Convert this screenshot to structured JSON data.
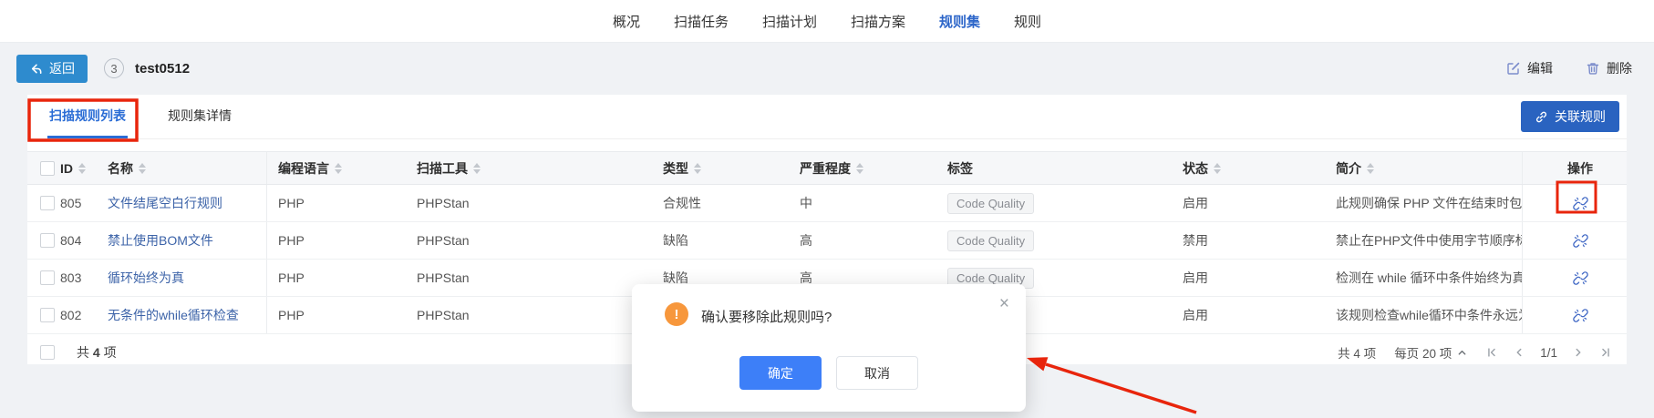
{
  "nav": {
    "items": [
      {
        "label": "概况"
      },
      {
        "label": "扫描任务"
      },
      {
        "label": "扫描计划"
      },
      {
        "label": "扫描方案"
      },
      {
        "label": "规则集"
      },
      {
        "label": "规则"
      }
    ]
  },
  "header": {
    "back_label": "返回",
    "badge_count": "3",
    "title": "test0512",
    "edit_label": "编辑",
    "delete_label": "删除"
  },
  "tabs": {
    "scan_rule_list": "扫描规则列表",
    "ruleset_detail": "规则集详情",
    "associate_label": "关联规则"
  },
  "table": {
    "columns": {
      "id": "ID",
      "name": "名称",
      "language": "编程语言",
      "tool": "扫描工具",
      "type": "类型",
      "severity": "严重程度",
      "tag": "标签",
      "status": "状态",
      "intro": "简介",
      "action": "操作"
    },
    "rows": [
      {
        "id": "805",
        "name": "文件结尾空白行规则",
        "language": "PHP",
        "tool": "PHPStan",
        "type": "合规性",
        "severity": "中",
        "tag": "Code Quality",
        "status": "启用",
        "intro": "此规则确保 PHP 文件在结束时包含一"
      },
      {
        "id": "804",
        "name": "禁止使用BOM文件",
        "language": "PHP",
        "tool": "PHPStan",
        "type": "缺陷",
        "severity": "高",
        "tag": "Code Quality",
        "status": "禁用",
        "intro": "禁止在PHP文件中使用字节顺序标记"
      },
      {
        "id": "803",
        "name": "循环始终为真",
        "language": "PHP",
        "tool": "PHPStan",
        "type": "缺陷",
        "severity": "高",
        "tag": "Code Quality",
        "status": "启用",
        "intro": "检测在 while 循环中条件始终为真的情"
      },
      {
        "id": "802",
        "name": "无条件的while循环检查",
        "language": "PHP",
        "tool": "PHPStan",
        "type": "",
        "severity": "",
        "tag": "",
        "status": "启用",
        "intro": "该规则检查while循环中条件永远为fals"
      }
    ],
    "footer": {
      "total_prefix": "共",
      "total_count": "4",
      "total_suffix": "项"
    }
  },
  "pagination": {
    "total": "共 4 项",
    "page_size": "每页 20 项",
    "page_indicator": "1/1"
  },
  "dialog": {
    "message": "确认要移除此规则吗?",
    "confirm_label": "确定",
    "cancel_label": "取消",
    "close_glyph": "×",
    "warn_glyph": "!"
  },
  "colors": {
    "accent_blue": "#2a63c0",
    "primary_blue": "#3d7ff8",
    "back_button_blue": "#2e8bce",
    "active_nav_blue": "#2d66c9",
    "link_blue": "#3c63a8",
    "disconnect_icon_blue": "#3e66c4",
    "warning_orange": "#f7973c",
    "annotation_red": "#e8250c"
  }
}
